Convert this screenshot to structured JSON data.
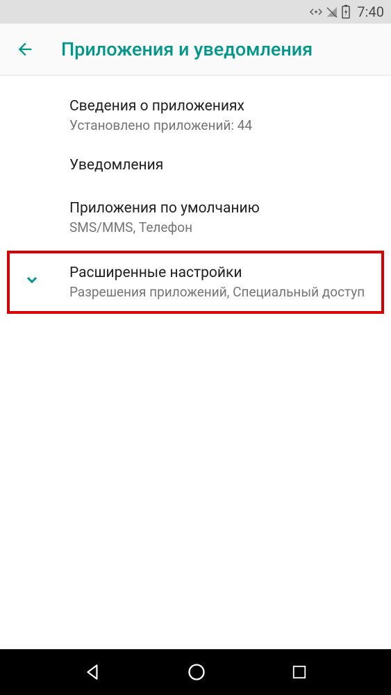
{
  "statusBar": {
    "time": "7:40"
  },
  "header": {
    "title": "Приложения и уведомления"
  },
  "items": [
    {
      "title": "Сведения о приложениях",
      "subtitle": "Установлено приложений: 44"
    },
    {
      "title": "Уведомления",
      "subtitle": ""
    },
    {
      "title": "Приложения по умолчанию",
      "subtitle": "SMS/MMS, Телефон"
    },
    {
      "title": "Расширенные настройки",
      "subtitle": "Разрешения приложений, Специальный доступ"
    }
  ],
  "colors": {
    "accent": "#009688",
    "highlight": "#d80000"
  }
}
